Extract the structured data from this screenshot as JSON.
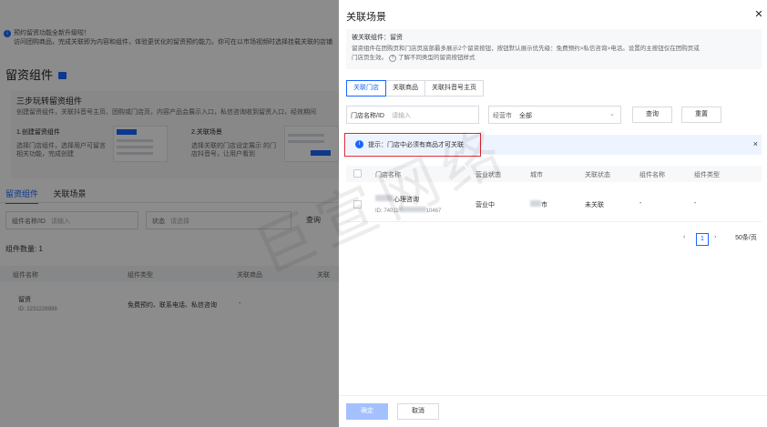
{
  "background": {
    "notice_line1": "预约留资功能全新升级啦！",
    "notice_line2": "访问团购商品，完成关联即为内容和组件，体验更优化的留资预约能力。你可在以市场视频时选择挂载关联的店铺",
    "page_title": "留资组件",
    "card_title": "三步玩转留资组件",
    "card_desc": "创建留资组件，关联抖音号主页、团购或门店页，内容产品会展示入口，私信咨询收到留资入口，经效期间",
    "step1_title": "1.创建留资组件",
    "step1_desc": "选择门店组件，选择用户可留言 相关功能，完成创建",
    "step2_title": "2.关联场景",
    "step2_desc": "选择关联的门店设定展示 的门店抖音号，让用户看到",
    "tabs": [
      "留资组件",
      "关联场景"
    ],
    "filter_label": "组件名称/ID",
    "filter_placeholder": "请输入",
    "status_label": "状态",
    "status_placeholder": "请选择",
    "query_label": "查询",
    "count_text": "组件数量: 1",
    "columns": [
      "组件名称",
      "组件类型",
      "关联商品",
      "关联"
    ],
    "row": {
      "name": "留资",
      "id": "ID: 2232228998",
      "type": "免费预约、联系电话、私信咨询",
      "goods": "-"
    }
  },
  "drawer": {
    "title": "关联场景",
    "close_icon": "close-icon",
    "info_line1": "被关联组件：留资",
    "info_line2a": "留资组件在团购页和门店页底部最多展示2个留资按钮，按钮默认展示优先级：免费预约>私信咨询>电话。设置的主按钮仅在团购页或",
    "info_line2b": "门店页生效。",
    "info_link": "了解不同类型的留资按钮样式",
    "tabs": [
      {
        "label": "关联门店",
        "active": true
      },
      {
        "label": "关联商品",
        "active": false
      },
      {
        "label": "关联抖音号主页",
        "active": false
      }
    ],
    "store_filter_label": "门店名称/ID",
    "store_filter_placeholder": "请输入",
    "city_label": "经营市",
    "city_value": "全部",
    "query_button": "查询",
    "reset_button": "重置",
    "alert_text": "提示：门店中必须有商品才可关联",
    "alert_close": "×",
    "columns": [
      "门店名称",
      "营业状态",
      "城市",
      "关联状态",
      "组件名称",
      "组件类型"
    ],
    "row": {
      "store_name": "心理咨询",
      "store_id": "ID: 74011",
      "store_id_tail": "10467",
      "status": "营业中",
      "city": "市",
      "link_status": "未关联",
      "component_name": "-",
      "component_type": "-"
    },
    "pagination": {
      "current": "1",
      "page_size": "50条/页"
    },
    "confirm_button": "确定",
    "cancel_button": "取消"
  },
  "watermark": "巨宣网络"
}
